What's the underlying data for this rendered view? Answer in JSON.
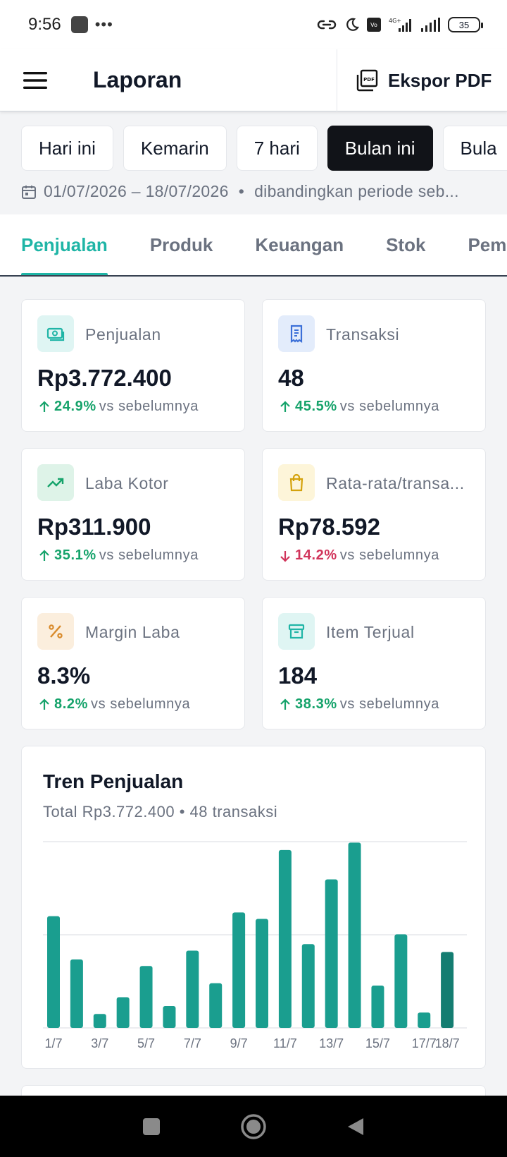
{
  "status_bar": {
    "time": "9:56",
    "battery": "35"
  },
  "app_bar": {
    "title": "Laporan",
    "export_label": "Ekspor PDF"
  },
  "filters": {
    "chips": [
      {
        "label": "Hari ini",
        "active": false
      },
      {
        "label": "Kemarin",
        "active": false
      },
      {
        "label": "7 hari",
        "active": false
      },
      {
        "label": "Bulan ini",
        "active": true
      },
      {
        "label": "Bula",
        "active": false
      }
    ],
    "date_range": "01/07/2026 – 18/07/2026",
    "compare_text": "dibandingkan periode seb..."
  },
  "tabs": [
    {
      "label": "Penjualan",
      "active": true
    },
    {
      "label": "Produk",
      "active": false
    },
    {
      "label": "Keuangan",
      "active": false
    },
    {
      "label": "Stok",
      "active": false
    },
    {
      "label": "Pemb",
      "active": false
    }
  ],
  "metrics": [
    {
      "label": "Penjualan",
      "value": "Rp3.772.400",
      "delta": "24.9%",
      "direction": "up",
      "suffix": "vs sebelumnya",
      "icon": "cash-icon",
      "icon_bg": "#dff5f3",
      "icon_color": "#1fb5a6"
    },
    {
      "label": "Transaksi",
      "value": "48",
      "delta": "45.5%",
      "direction": "up",
      "suffix": "vs sebelumnya",
      "icon": "receipt-icon",
      "icon_bg": "#e3ecfb",
      "icon_color": "#3b6fd8"
    },
    {
      "label": "Laba Kotor",
      "value": "Rp311.900",
      "delta": "35.1%",
      "direction": "up",
      "suffix": "vs sebelumnya",
      "icon": "trending-up-icon",
      "icon_bg": "#def3e8",
      "icon_color": "#16a36b"
    },
    {
      "label": "Rata-rata/transa...",
      "value": "Rp78.592",
      "delta": "14.2%",
      "direction": "down",
      "suffix": "vs sebelumnya",
      "icon": "shopping-bag-icon",
      "icon_bg": "#fdf5d9",
      "icon_color": "#d4a20c"
    },
    {
      "label": "Margin Laba",
      "value": "8.3%",
      "delta": "8.2%",
      "direction": "up",
      "suffix": "vs sebelumnya",
      "icon": "percent-icon",
      "icon_bg": "#fbeedd",
      "icon_color": "#d98a2a"
    },
    {
      "label": "Item Terjual",
      "value": "184",
      "delta": "38.3%",
      "direction": "up",
      "suffix": "vs sebelumnya",
      "icon": "archive-box-icon",
      "icon_bg": "#dff5f3",
      "icon_color": "#1fb5a6"
    }
  ],
  "chart_data": {
    "type": "bar",
    "title": "Tren Penjualan",
    "subtitle": "Total Rp3.772.400 • 48 transaksi",
    "categories": [
      "1/7",
      "2/7",
      "3/7",
      "4/7",
      "5/7",
      "6/7",
      "7/7",
      "8/7",
      "9/7",
      "10/7",
      "11/7",
      "12/7",
      "13/7",
      "14/7",
      "15/7",
      "16/7",
      "17/7",
      "18/7"
    ],
    "tick_labels": [
      "1/7",
      "3/7",
      "5/7",
      "7/7",
      "9/7",
      "11/7",
      "13/7",
      "15/7",
      "17/7",
      "18/7"
    ],
    "values": [
      240,
      147,
      30,
      66,
      133,
      47,
      166,
      96,
      248,
      234,
      382,
      180,
      319,
      398,
      91,
      201,
      33,
      163
    ],
    "ylim": [
      0,
      400
    ],
    "grid": true,
    "bar_color": "#1a9e8f",
    "highlight_color": "#147d71",
    "highlight_index": 17
  },
  "colors": {
    "accent": "#1fb5a6",
    "positive": "#16a36b",
    "negative": "#d1345b",
    "active_chip": "#111318"
  }
}
